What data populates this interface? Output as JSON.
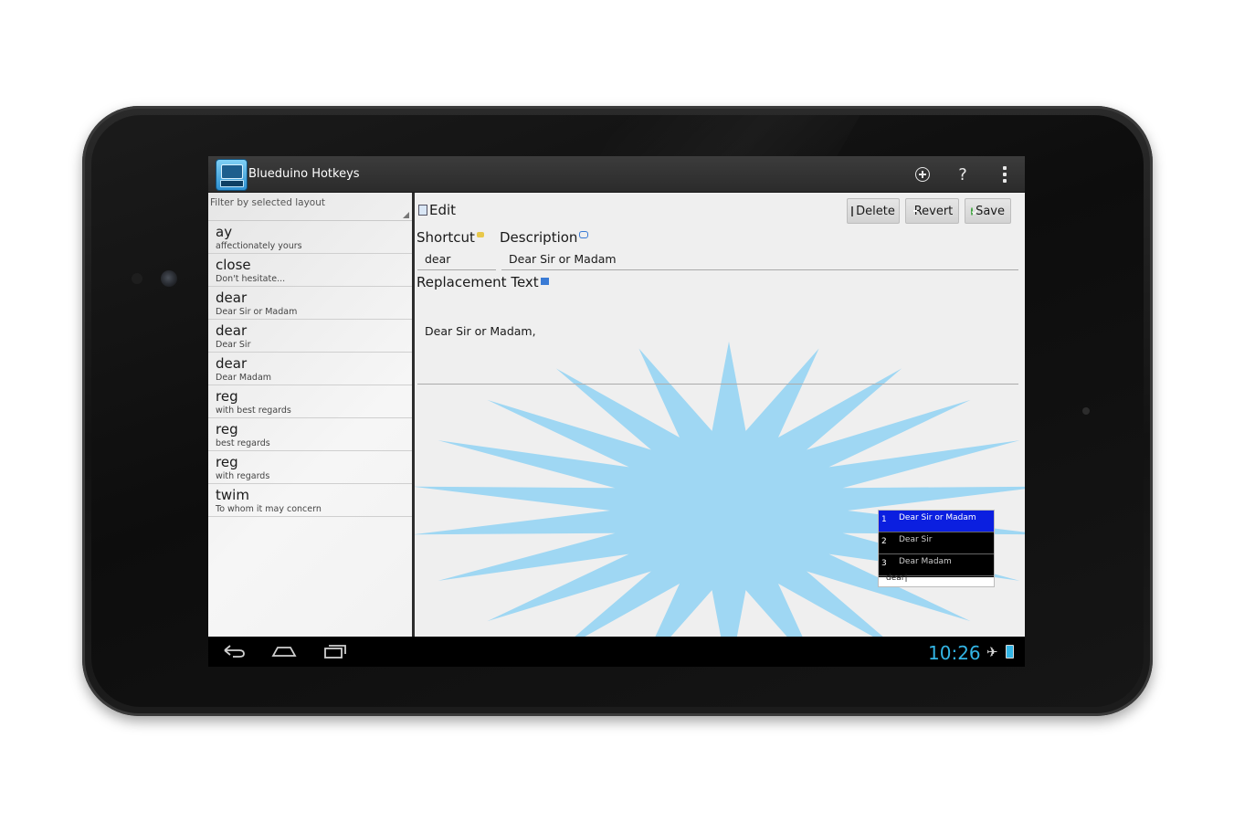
{
  "app": {
    "title": "Blueduino Hotkeys",
    "actions": {
      "add_icon": "add-icon",
      "help_label": "?",
      "overflow_icon": "overflow-icon"
    }
  },
  "left_pane": {
    "filter_placeholder": "Filter by selected layout",
    "items": [
      {
        "shortcut": "ay",
        "description": "affectionately yours"
      },
      {
        "shortcut": "close",
        "description": "Don't hesitate..."
      },
      {
        "shortcut": "dear",
        "description": "Dear Sir or Madam"
      },
      {
        "shortcut": "dear",
        "description": "Dear Sir"
      },
      {
        "shortcut": "dear",
        "description": "Dear Madam"
      },
      {
        "shortcut": "reg",
        "description": "with best regards"
      },
      {
        "shortcut": "reg",
        "description": "best regards"
      },
      {
        "shortcut": "reg",
        "description": "with regards"
      },
      {
        "shortcut": "twim",
        "description": "To whom it may concern"
      }
    ]
  },
  "editor": {
    "title": "Edit",
    "buttons": {
      "delete": "Delete",
      "revert": "Revert",
      "save": "Save"
    },
    "shortcut_label": "Shortcut",
    "shortcut_value": "dear",
    "description_label": "Description",
    "description_value": "Dear Sir or Madam",
    "replacement_label": "Replacement Text",
    "replacement_value": "Dear Sir or Madam,"
  },
  "suggestions": {
    "items": [
      {
        "n": "1",
        "text": "Dear Sir or Madam",
        "selected": true
      },
      {
        "n": "2",
        "text": "Dear Sir",
        "selected": false
      },
      {
        "n": "3",
        "text": "Dear Madam",
        "selected": false
      }
    ],
    "typed": "dear|"
  },
  "statusbar": {
    "time": "10:26"
  },
  "colors": {
    "accent": "#33b5e5",
    "burst": "#9fd7f3",
    "selected": "#0b1fe0"
  }
}
